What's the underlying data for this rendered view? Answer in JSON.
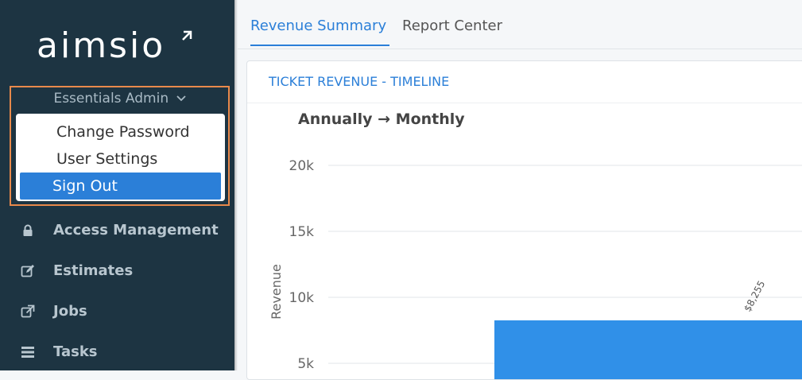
{
  "sidebar": {
    "logo_text": "aimsio",
    "user": {
      "name": "Essentials Admin"
    },
    "dropdown": [
      {
        "label": "Change Password"
      },
      {
        "label": "User Settings"
      },
      {
        "label": "Sign Out"
      }
    ],
    "nav": [
      {
        "label": "Access Management",
        "icon": "lock-icon"
      },
      {
        "label": "Estimates",
        "icon": "edit-icon"
      },
      {
        "label": "Jobs",
        "icon": "external-link-icon"
      },
      {
        "label": "Tasks",
        "icon": "list-icon"
      }
    ]
  },
  "tabs": [
    {
      "label": "Revenue Summary"
    },
    {
      "label": "Report Center"
    }
  ],
  "card": {
    "header": "TICKET REVENUE - TIMELINE"
  },
  "chart_data": {
    "type": "bar",
    "title": "Annually → Monthly",
    "ylabel": "Revenue",
    "yticks": [
      "20k",
      "15k",
      "10k",
      "5k"
    ],
    "ylim": [
      0,
      20000
    ],
    "values": [
      8255
    ],
    "data_labels": [
      "$8,255"
    ],
    "bar_color": "#3090e8"
  },
  "colors": {
    "sidebar_bg": "#1d3442",
    "accent": "#2b7fd8",
    "highlight_border": "#e8894b"
  }
}
